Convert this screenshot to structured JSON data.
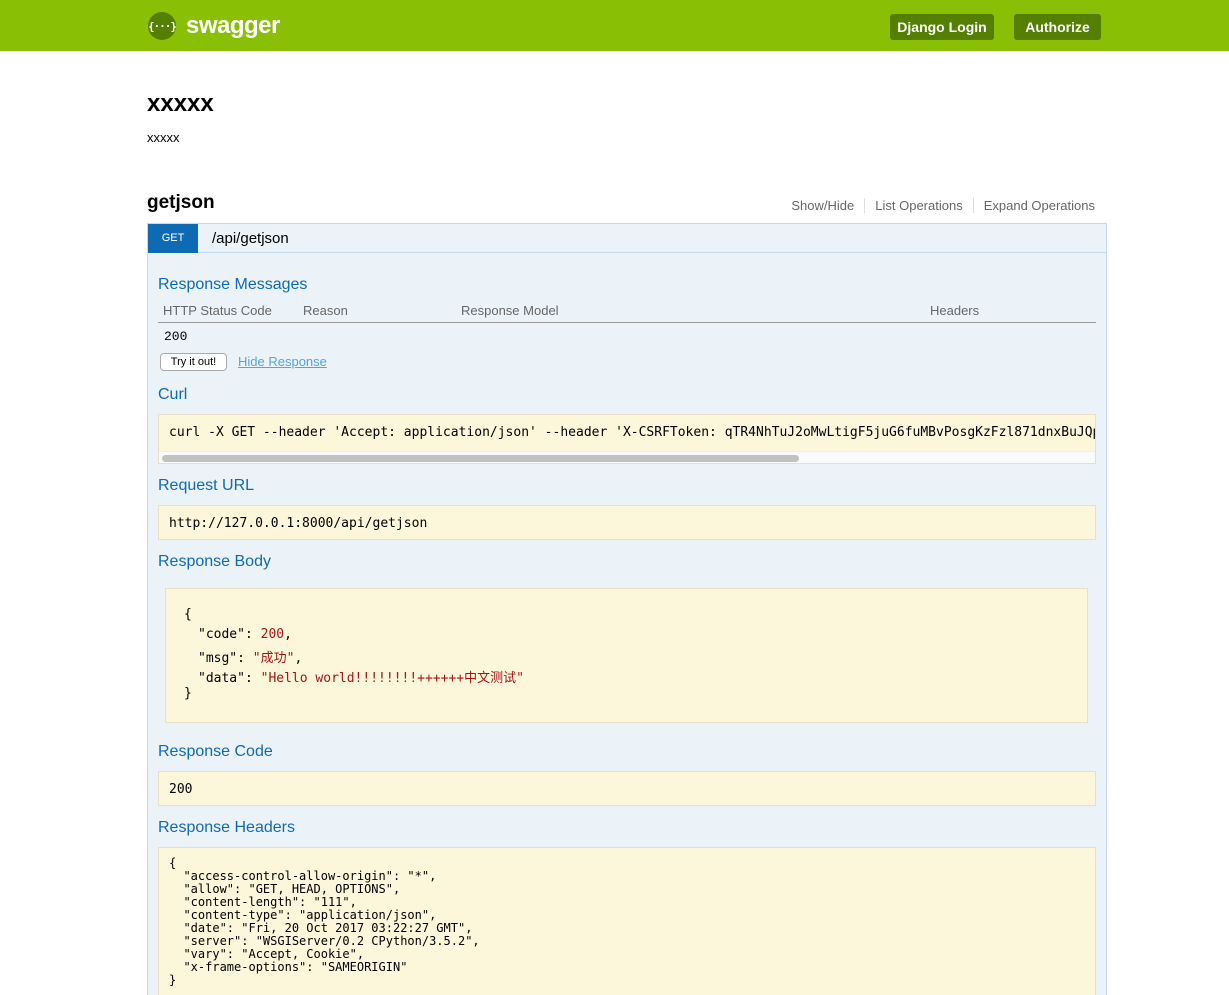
{
  "header": {
    "logo_symbol": "{···}",
    "logo_text": "swagger",
    "login_label": "Django Login",
    "authorize_label": "Authorize",
    "bar_color": "#89bf04"
  },
  "info": {
    "title": "xxxxx",
    "description": "xxxxx"
  },
  "resource": {
    "name": "getjson",
    "links": [
      "Show/Hide",
      "List Operations",
      "Expand Operations"
    ]
  },
  "operation": {
    "method": "GET",
    "path": "/api/getjson",
    "response_messages_title": "Response Messages",
    "columns": [
      "HTTP Status Code",
      "Reason",
      "Response Model",
      "Headers"
    ],
    "status_row": "200",
    "try_label": "Try it out!",
    "hide_label": "Hide Response",
    "curl_title": "Curl",
    "curl_text": "curl -X GET --header 'Accept: application/json' --header 'X-CSRFToken: qTR4NhTuJ2oMwLtigF5juG6fuMBvPosgKzFzl871dnxBuJQp",
    "request_url_title": "Request URL",
    "request_url": "http://127.0.0.1:8000/api/getjson",
    "response_body_title": "Response Body",
    "body": {
      "open": "{",
      "k1": "\"code\": ",
      "v1": "200",
      "k2": "\"msg\": ",
      "v2": "\"成功\"",
      "k3": "\"data\": ",
      "v3": "\"Hello world!!!!!!!!++++++中文测试\"",
      "close": "}"
    },
    "response_code_title": "Response Code",
    "response_code": "200",
    "response_headers_title": "Response Headers",
    "headers_lines": [
      "{",
      "  \"access-control-allow-origin\": \"*\",",
      "  \"allow\": \"GET, HEAD, OPTIONS\",",
      "  \"content-length\": \"111\",",
      "  \"content-type\": \"application/json\",",
      "  \"date\": \"Fri, 20 Oct 2017 03:22:27 GMT\",",
      "  \"server\": \"WSGIServer/0.2 CPython/3.5.2\",",
      "  \"vary\": \"Accept, Cookie\",",
      "  \"x-frame-options\": \"SAMEORIGIN\"",
      "}"
    ]
  }
}
